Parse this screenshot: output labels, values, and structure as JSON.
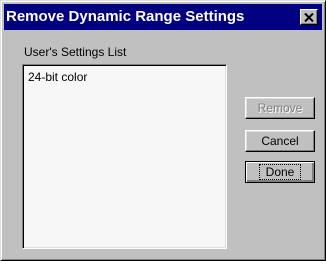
{
  "window": {
    "title": "Remove Dynamic Range Settings",
    "close_glyph": "×"
  },
  "list": {
    "label": "User's Settings List",
    "items": [
      "24-bit color"
    ]
  },
  "buttons": {
    "remove": {
      "label": "Remove",
      "enabled": false
    },
    "cancel": {
      "label": "Cancel",
      "enabled": true
    },
    "done": {
      "label": "Done",
      "enabled": true,
      "default": true
    }
  },
  "icons": {
    "close": "close-icon"
  },
  "colors": {
    "titlebar": "#000080",
    "face": "#c0c0c0",
    "listbox": "#f7f7f7"
  }
}
